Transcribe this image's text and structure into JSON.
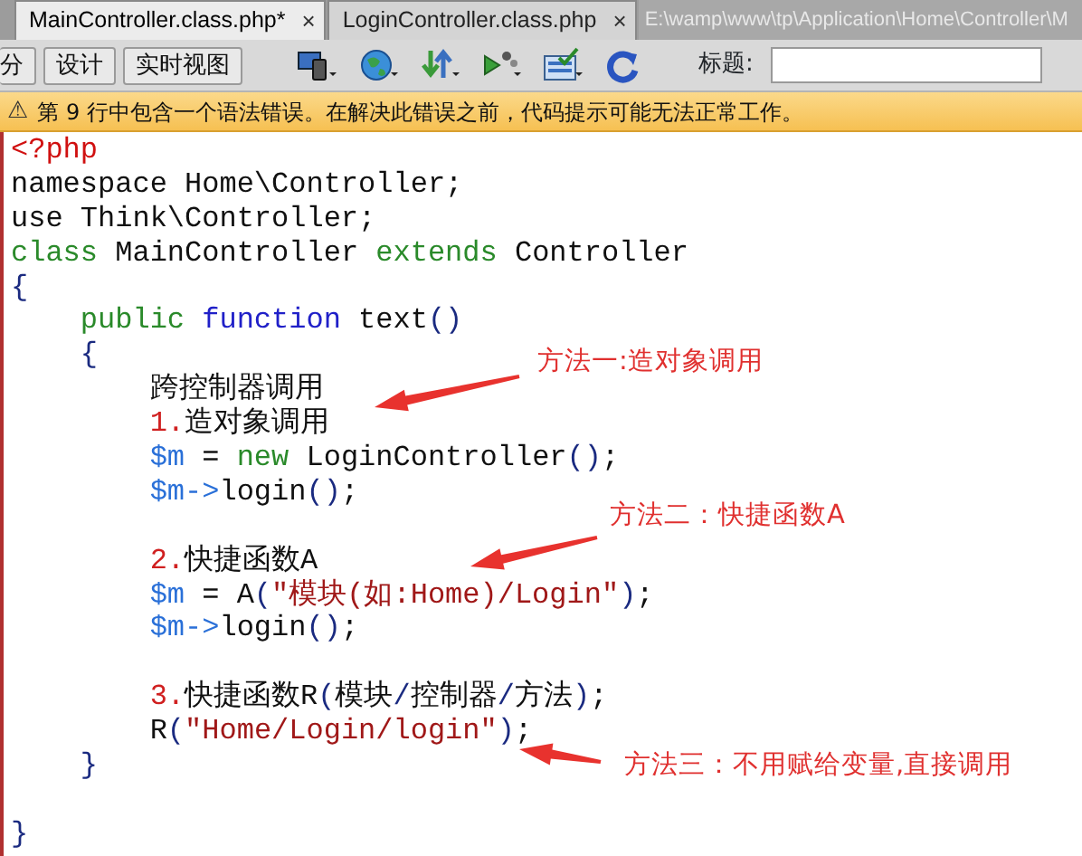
{
  "tabs": [
    {
      "label": "MainController.class.php*",
      "selected": true,
      "close": "×"
    },
    {
      "label": "LoginController.class.php",
      "selected": false,
      "close": "×"
    }
  ],
  "file_path": "E:\\wamp\\www\\tp\\Application\\Home\\Controller\\M",
  "toolbar": {
    "view_buttons": [
      {
        "label": "分"
      },
      {
        "label": "设计"
      },
      {
        "label": "实时视图"
      }
    ],
    "title_label": "标题:"
  },
  "warning": {
    "icon": "⚠",
    "text": "第 9 行中包含一个语法错误。在解决此错误之前，代码提示可能无法正常工作。"
  },
  "code_lines": [
    {
      "kind": "code",
      "tokens": [
        {
          "kind": "tag",
          "text": "<?php"
        }
      ]
    },
    {
      "kind": "code",
      "tokens": [
        {
          "kind": "plain",
          "text": "namespace Home\\Controller;"
        }
      ]
    },
    {
      "kind": "code",
      "tokens": [
        {
          "kind": "plain",
          "text": "use Think\\Controller;"
        }
      ]
    },
    {
      "kind": "code",
      "tokens": [
        {
          "kind": "keyword",
          "text": "class"
        },
        {
          "kind": "plain",
          "text": " MainController "
        },
        {
          "kind": "keyword",
          "text": "extends"
        },
        {
          "kind": "plain",
          "text": " Controller"
        }
      ]
    },
    {
      "kind": "code",
      "tokens": [
        {
          "kind": "punct",
          "text": "{"
        }
      ]
    },
    {
      "kind": "code",
      "tokens": [
        {
          "kind": "keyword",
          "text": "    public"
        },
        {
          "kind": "function",
          "text": " function"
        },
        {
          "kind": "plain",
          "text": " text"
        },
        {
          "kind": "punct",
          "text": "()"
        }
      ]
    },
    {
      "kind": "code",
      "tokens": [
        {
          "kind": "punct",
          "text": "    {"
        }
      ]
    },
    {
      "kind": "code",
      "tokens": [
        {
          "kind": "plain",
          "text": "        跨控制器调用"
        }
      ]
    },
    {
      "kind": "code",
      "tokens": [
        {
          "kind": "number",
          "text": "        1."
        },
        {
          "kind": "plain",
          "text": "造对象调用"
        }
      ]
    },
    {
      "kind": "code",
      "tokens": [
        {
          "kind": "variable",
          "text": "        $m"
        },
        {
          "kind": "plain",
          "text": " = "
        },
        {
          "kind": "keyword",
          "text": "new"
        },
        {
          "kind": "plain",
          "text": " LoginController"
        },
        {
          "kind": "punct",
          "text": "()"
        },
        {
          "kind": "plain",
          "text": ";"
        }
      ]
    },
    {
      "kind": "code",
      "tokens": [
        {
          "kind": "variable",
          "text": "        $m->"
        },
        {
          "kind": "plain",
          "text": "login"
        },
        {
          "kind": "punct",
          "text": "()"
        },
        {
          "kind": "plain",
          "text": ";"
        }
      ]
    },
    {
      "kind": "blank"
    },
    {
      "kind": "code",
      "tokens": [
        {
          "kind": "number",
          "text": "        2."
        },
        {
          "kind": "plain",
          "text": "快捷函数A"
        }
      ]
    },
    {
      "kind": "code",
      "tokens": [
        {
          "kind": "variable",
          "text": "        $m"
        },
        {
          "kind": "plain",
          "text": " = A"
        },
        {
          "kind": "punct",
          "text": "("
        },
        {
          "kind": "string",
          "text": "\"模块(如:Home)/Login\""
        },
        {
          "kind": "punct",
          "text": ")"
        },
        {
          "kind": "plain",
          "text": ";"
        }
      ]
    },
    {
      "kind": "code",
      "tokens": [
        {
          "kind": "variable",
          "text": "        $m->"
        },
        {
          "kind": "plain",
          "text": "login"
        },
        {
          "kind": "punct",
          "text": "()"
        },
        {
          "kind": "plain",
          "text": ";"
        }
      ]
    },
    {
      "kind": "blank"
    },
    {
      "kind": "code",
      "tokens": [
        {
          "kind": "number",
          "text": "        3."
        },
        {
          "kind": "plain",
          "text": "快捷函数R"
        },
        {
          "kind": "punct",
          "text": "("
        },
        {
          "kind": "plain",
          "text": "模块"
        },
        {
          "kind": "punct",
          "text": "/"
        },
        {
          "kind": "plain",
          "text": "控制器"
        },
        {
          "kind": "punct",
          "text": "/"
        },
        {
          "kind": "plain",
          "text": "方法"
        },
        {
          "kind": "punct",
          "text": ")"
        },
        {
          "kind": "plain",
          "text": ";"
        }
      ]
    },
    {
      "kind": "code",
      "tokens": [
        {
          "kind": "plain",
          "text": "        R"
        },
        {
          "kind": "punct",
          "text": "("
        },
        {
          "kind": "string",
          "text": "\"Home/Login/login\""
        },
        {
          "kind": "punct",
          "text": ")"
        },
        {
          "kind": "plain",
          "text": ";"
        }
      ]
    },
    {
      "kind": "code",
      "tokens": [
        {
          "kind": "punct",
          "text": "    }"
        }
      ]
    },
    {
      "kind": "blank"
    },
    {
      "kind": "code",
      "tokens": [
        {
          "kind": "punct",
          "text": "}"
        }
      ]
    }
  ],
  "annotations": [
    {
      "text": "方法一:造对象调用"
    },
    {
      "text": "方法二：快捷函数A"
    },
    {
      "text": "方法三：不用赋给变量,直接调用"
    }
  ]
}
